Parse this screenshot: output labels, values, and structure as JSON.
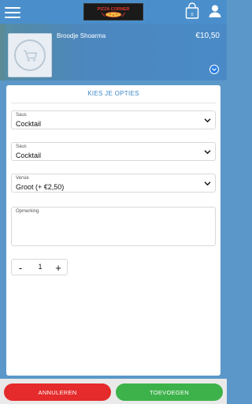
{
  "header": {
    "logo_text": "PIZZA CORNER",
    "cart_count": "0"
  },
  "product": {
    "name": "Broodje Shoarma",
    "price": "€10,50"
  },
  "options": {
    "title": "KIES JE OPTIES",
    "fields": [
      {
        "label": "Saus",
        "value": "Cocktail"
      },
      {
        "label": "Saus",
        "value": "Cocktail"
      },
      {
        "label": "Versie",
        "value": "Groot (+ €2,50)"
      }
    ],
    "remark_label": "Opmerking",
    "remark_value": "",
    "quantity": "1",
    "minus": "-",
    "plus": "+"
  },
  "actions": {
    "cancel_label": "ANNULEREN",
    "add_label": "TOEVOEGEN"
  },
  "colors": {
    "accent": "#3a86c8",
    "cancel": "#e52b2b",
    "confirm": "#3db24a"
  }
}
